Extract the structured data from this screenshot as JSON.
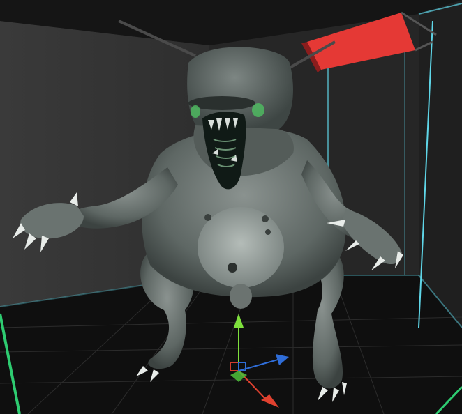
{
  "viewport": {
    "colors": {
      "back_wall": "#343434",
      "back_wall_right": "#2a2a2a",
      "floor": "#0f0f0f",
      "grid_line": "#2c2c2c",
      "edge_cyan": "#5fd6e8",
      "edge_green": "#2ecc71",
      "ceiling_panel": "#e53935",
      "creature_body": "#6f7875",
      "creature_shadow": "#3c4341",
      "creature_belly": "#9aa39f",
      "mouth_inner": "#101a16",
      "eye_glow": "#4fbf62"
    }
  },
  "gizmo": {
    "colors": {
      "axis_y": "#7ee03c",
      "axis_x": "#2f6dd8",
      "axis_z": "#e0412f",
      "center_red": "#d33b2b",
      "center_green": "#4fbf3b",
      "center_blue": "#2f6dd8"
    },
    "icons": [
      "y-axis-arrow-icon",
      "x-axis-arrow-icon",
      "z-axis-arrow-icon",
      "center-cube-icon"
    ]
  }
}
